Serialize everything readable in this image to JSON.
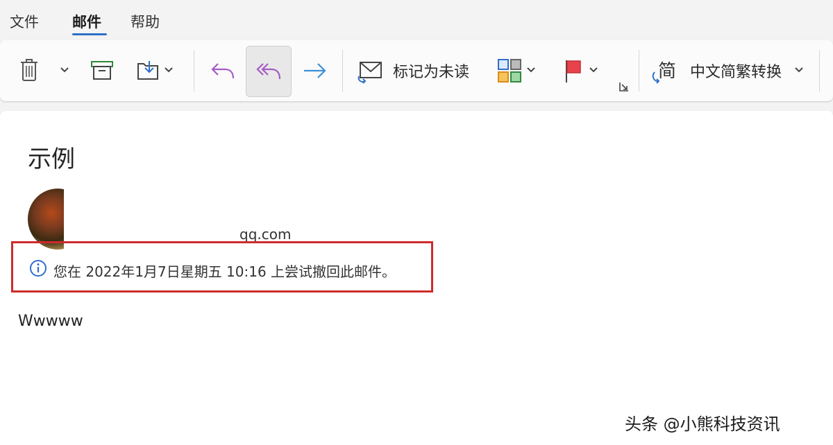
{
  "menu": {
    "items": [
      "文件",
      "邮件",
      "帮助"
    ],
    "active_index": 1
  },
  "ribbon": {
    "mark_unread_label": "标记为未读",
    "convert_label": "中文简繁转换",
    "convert_icon_glyph": "简",
    "icons": [
      "trash-icon",
      "archive-icon",
      "move-icon",
      "reply-icon",
      "reply-all-icon",
      "forward-icon",
      "mail-icon",
      "categorize-icon",
      "flag-icon",
      "expand-icon"
    ]
  },
  "message": {
    "subject": "示例",
    "sender_email": "qq.com",
    "recall_notice": "您在 2022年1月7日星期五 10:16 上尝试撤回此邮件。",
    "body": "Wwwww"
  },
  "watermark": "头条 @小熊科技资讯",
  "colors": {
    "accent": "#2f6fc9",
    "highlight_border": "#cc2b2b",
    "reply_purple": "#a45bc6",
    "forward_blue": "#3a8ed8"
  }
}
